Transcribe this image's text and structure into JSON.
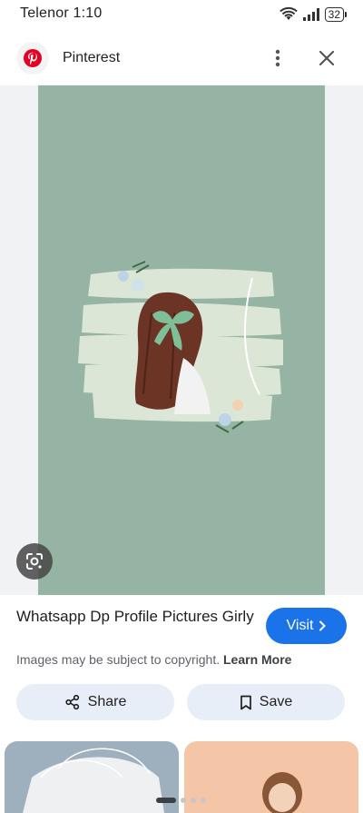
{
  "status_bar": {
    "carrier_time": "Telenor 1:10",
    "battery": "32"
  },
  "header": {
    "site_name": "Pinterest",
    "logo_icon": "pinterest-logo-icon",
    "more_icon": "more-vert-icon",
    "close_icon": "close-icon",
    "brand_color": "#e60023"
  },
  "image": {
    "background_color": "#95b4a3",
    "lens_icon": "google-lens-icon"
  },
  "result": {
    "title": "Whatsapp Dp Profile Pictures Girly",
    "visit_label": "Visit",
    "visit_color": "#1a73e8",
    "copyright_text": "Images may be subject to copyright.",
    "learn_more": "Learn More",
    "share_label": "Share",
    "save_label": "Save"
  },
  "pager": {
    "pages": 4,
    "active": 0
  }
}
